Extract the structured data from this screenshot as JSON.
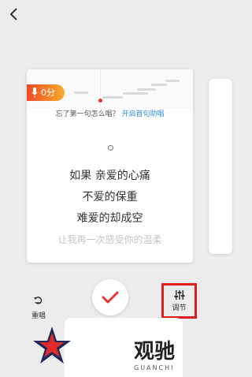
{
  "score": {
    "value": "0分"
  },
  "hint": {
    "question": "忘了第一句怎么唱？",
    "action": "开启首句助唱"
  },
  "lyrics": [
    "如果 亲爱的心痛",
    "不爱的保重",
    "难爱的却成空",
    "让我再一次感受你的温柔"
  ],
  "controls": {
    "retry_label": "重唱",
    "done_label": "完成",
    "adjust_label": "调节"
  },
  "watermark": {
    "title": "观驰",
    "subtitle": "GUANCHI"
  },
  "colors": {
    "accent": "#e83333",
    "link": "#2a8fe8",
    "badge_start": "#ee4a26",
    "badge_end": "#f7ad2d",
    "highlight_border": "#e01d1d"
  },
  "icons": {
    "back": "chevron-left-icon",
    "retry": "retry-icon",
    "done": "checkmark-icon",
    "adjust": "equalizer-icon",
    "mic": "microphone-icon"
  }
}
